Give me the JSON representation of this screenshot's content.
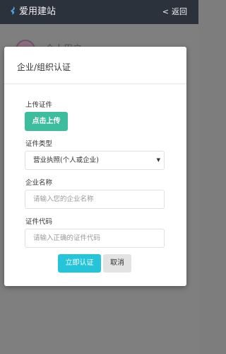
{
  "navbar": {
    "brand": "爱用建站",
    "back_label": "返回",
    "back_chevron": "<"
  },
  "background": {
    "title": "个人用户"
  },
  "modal": {
    "title": "企业/组织认证",
    "upload_label": "上传证件",
    "upload_button": "点击上传",
    "type_label": "证件类型",
    "type_selected": "营业执照(个人或企业)",
    "name_label": "企业名称",
    "name_placeholder": "请输入您的企业名称",
    "code_label": "证件代码",
    "code_placeholder": "请输入正确的证件代码",
    "submit_button": "立即认证",
    "cancel_button": "取消"
  },
  "colors": {
    "navbar": "#2b323c",
    "upload": "#3dbd9e",
    "submit": "#25c4d9",
    "cancel": "#e3e3e3"
  }
}
